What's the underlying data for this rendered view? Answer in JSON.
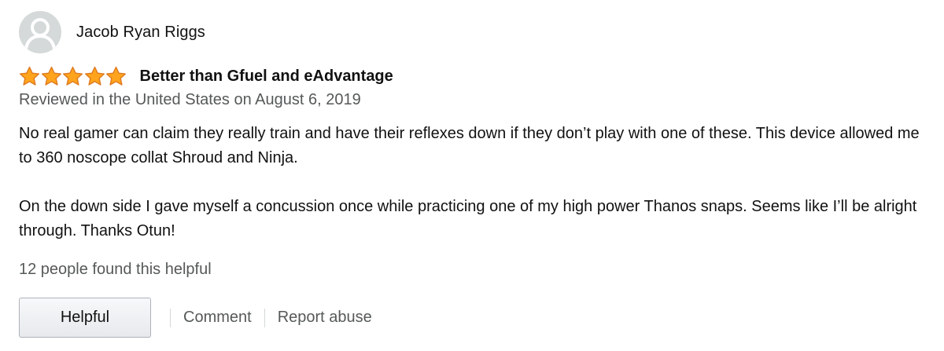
{
  "reviewer": {
    "name": "Jacob Ryan Riggs",
    "avatar_icon": "user-silhouette-icon"
  },
  "rating": {
    "stars": 5,
    "max": 5,
    "star_color": "#ffa41c"
  },
  "review": {
    "title": "Better than Gfuel and eAdvantage",
    "date": "Reviewed in the United States on August 6, 2019",
    "paragraphs": [
      "No real gamer can claim they really train and have their reflexes down if they don’t play with one of these. This device allowed me to 360 noscope collat Shroud and Ninja.",
      "On the down side I gave myself a concussion once while practicing one of my high power Thanos snaps. Seems like I’ll be alright through. Thanks Otun!"
    ]
  },
  "helpful_count_text": "12 people found this helpful",
  "actions": {
    "helpful_label": "Helpful",
    "comment_label": "Comment",
    "report_label": "Report abuse"
  },
  "colors": {
    "text_primary": "#111111",
    "text_secondary": "#565959",
    "avatar_bg": "#d5d9d9",
    "avatar_fg": "#ffffff"
  }
}
